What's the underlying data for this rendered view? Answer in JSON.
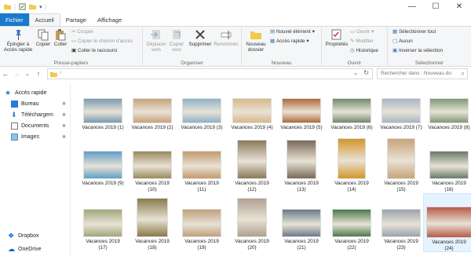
{
  "tabs": {
    "file": "Fichier",
    "home": "Accueil",
    "share": "Partage",
    "view": "Affichage"
  },
  "ribbon": {
    "pin": "Épingler à Accès rapide",
    "copy": "Copier",
    "paste": "Coller",
    "cut": "Couper",
    "copy_path": "Copier le chemin d'accès",
    "paste_shortcut": "Coller le raccourci",
    "clipboard": "Presse-papiers",
    "move": "Déplacer vers",
    "copy_to": "Copier vers",
    "delete": "Supprimer",
    "rename": "Renommer",
    "organize": "Organiser",
    "new_folder": "Nouveau dossier",
    "new_item": "Nouvel élément",
    "easy_access": "Accès rapide",
    "new": "Nouveau",
    "properties": "Propriétés",
    "open_btn": "Ouvrir",
    "edit": "Modifier",
    "history": "Historique",
    "open": "Ouvrir",
    "select_all": "Sélectionner tout",
    "select_none": "Aucun",
    "invert": "Inverser la sélection",
    "select": "Sélectionner"
  },
  "search": {
    "placeholder": "Rechercher dans : Nouveau do"
  },
  "nav": {
    "quick": "Accès rapide",
    "desktop": "Bureau",
    "downloads": "Téléchargem",
    "documents": "Documents",
    "images": "Images",
    "dropbox": "Dropbox",
    "onedrive": "OneDrive"
  },
  "files": [
    {
      "l1": "Vacances 2019 (1)",
      "l2": "",
      "c": "#7a9bb0"
    },
    {
      "l1": "Vacances 2019 (2)",
      "l2": "",
      "c": "#c9a27a"
    },
    {
      "l1": "Vacances 2019 (3)",
      "l2": "",
      "c": "#8fb2c9"
    },
    {
      "l1": "Vacances 2019 (4)",
      "l2": "",
      "c": "#d9b88a"
    },
    {
      "l1": "Vacances 2019 (5)",
      "l2": "",
      "c": "#b06a3a"
    },
    {
      "l1": "Vacances 2019 (6)",
      "l2": "",
      "c": "#6f8a6a"
    },
    {
      "l1": "Vacances 2019 (7)",
      "l2": "",
      "c": "#a7b6c4"
    },
    {
      "l1": "Vacances 2019 (8)",
      "l2": "",
      "c": "#7e9a74"
    },
    {
      "l1": "Vacances 2019 (9)",
      "l2": "",
      "c": "#5fa0c8"
    },
    {
      "l1": "Vacances 2019",
      "l2": "(10)",
      "c": "#9a8a5c"
    },
    {
      "l1": "Vacances 2019",
      "l2": "(11)",
      "c": "#c49a6c"
    },
    {
      "l1": "Vacances 2019",
      "l2": "(12)",
      "c": "#8a7a5a"
    },
    {
      "l1": "Vacances 2019",
      "l2": "(13)",
      "c": "#7a6a5a"
    },
    {
      "l1": "Vacances 2019",
      "l2": "(14)",
      "c": "#d4962a"
    },
    {
      "l1": "Vacances 2019",
      "l2": "(15)",
      "c": "#c8a47a"
    },
    {
      "l1": "Vacances 2019",
      "l2": "(16)",
      "c": "#6a7a6a"
    },
    {
      "l1": "Vacances 2019",
      "l2": "(17)",
      "c": "#a0a87a"
    },
    {
      "l1": "Vacances 2019",
      "l2": "(18)",
      "c": "#8a7a4a"
    },
    {
      "l1": "Vacances 2019",
      "l2": "(19)",
      "c": "#c0a07a"
    },
    {
      "l1": "Vacances 2019",
      "l2": "(20)",
      "c": "#b0a090"
    },
    {
      "l1": "Vacances 2019",
      "l2": "(21)",
      "c": "#6a7a8a"
    },
    {
      "l1": "Vacances 2019",
      "l2": "(22)",
      "c": "#4a7a4a"
    },
    {
      "l1": "Vacances 2019",
      "l2": "(23)",
      "c": "#9aa4ac"
    },
    {
      "l1": "Vacances 2019",
      "l2": "(24)",
      "c": "#b85a4a"
    }
  ]
}
